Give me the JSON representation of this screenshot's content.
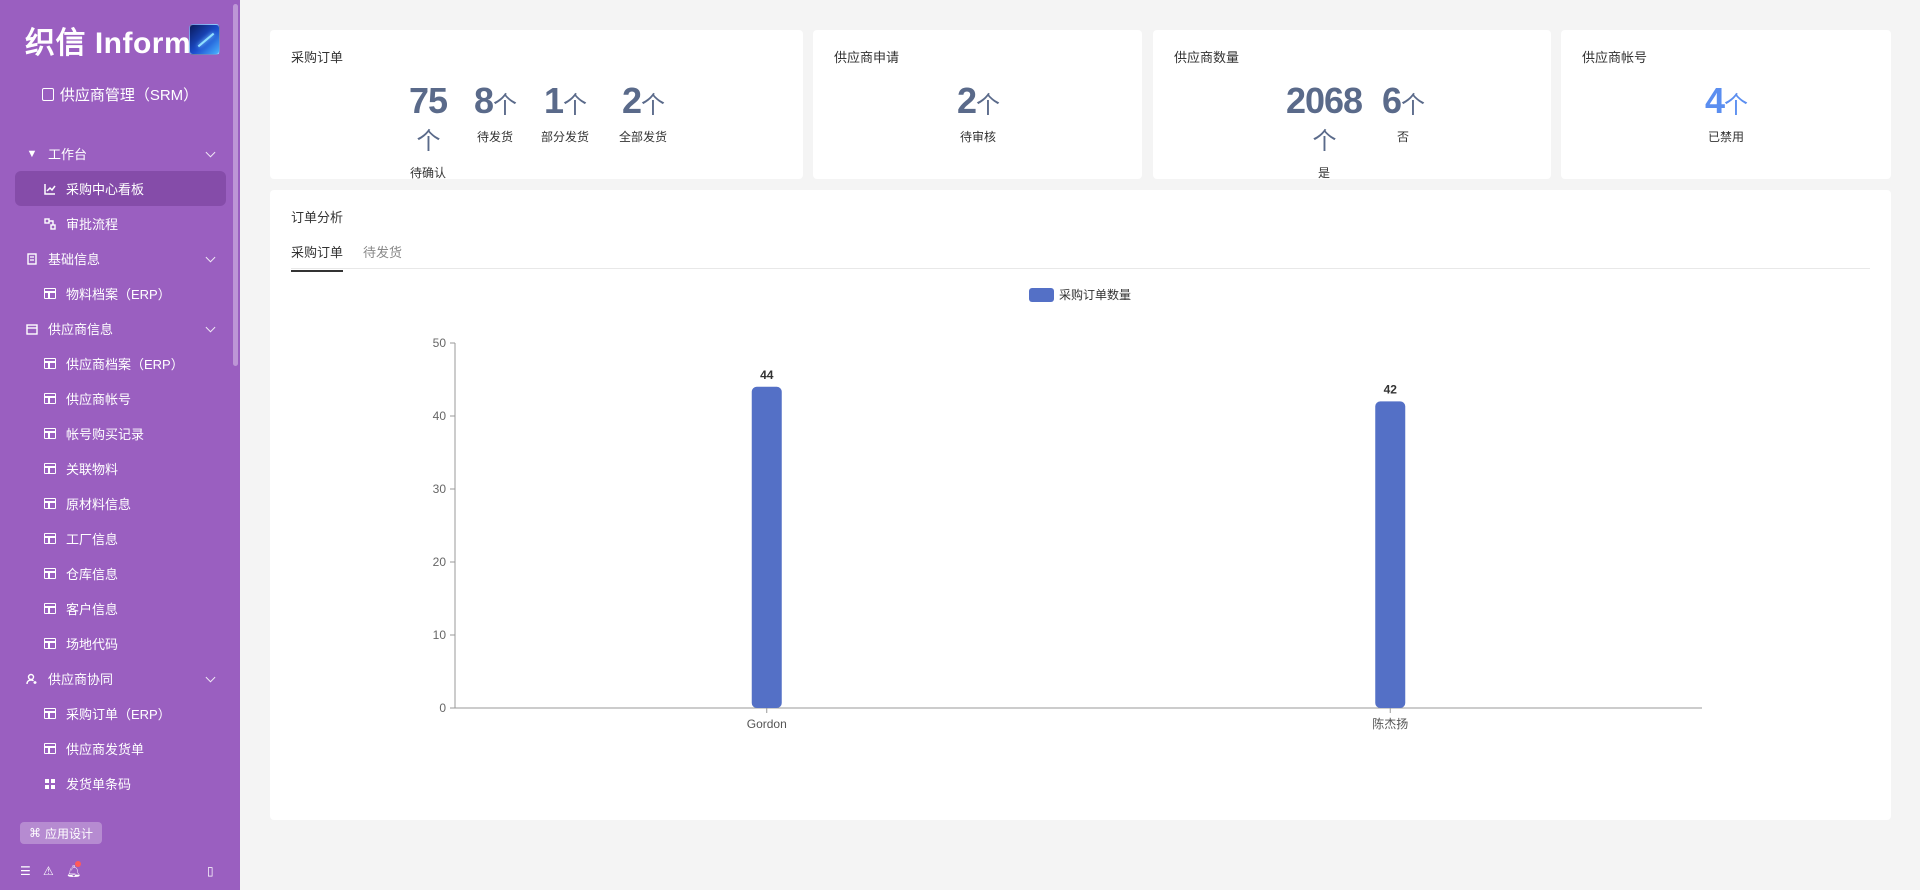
{
  "sidebar": {
    "brand": "织信 Informat",
    "app_name": "供应商管理（SRM）",
    "items": [
      {
        "label": "工作台",
        "type": "group"
      },
      {
        "label": "采购中心看板",
        "type": "child"
      },
      {
        "label": "审批流程",
        "type": "child"
      },
      {
        "label": "基础信息",
        "type": "group"
      },
      {
        "label": "物料档案（ERP）",
        "type": "child"
      },
      {
        "label": "供应商信息",
        "type": "group"
      },
      {
        "label": "供应商档案（ERP）",
        "type": "child"
      },
      {
        "label": "供应商帐号",
        "type": "child"
      },
      {
        "label": "帐号购买记录",
        "type": "child"
      },
      {
        "label": "关联物料",
        "type": "child"
      },
      {
        "label": "原材料信息",
        "type": "child"
      },
      {
        "label": "工厂信息",
        "type": "child"
      },
      {
        "label": "仓库信息",
        "type": "child"
      },
      {
        "label": "客户信息",
        "type": "child"
      },
      {
        "label": "场地代码",
        "type": "child"
      },
      {
        "label": "供应商协同",
        "type": "group"
      },
      {
        "label": "采购订单（ERP）",
        "type": "child"
      },
      {
        "label": "供应商发货单",
        "type": "child"
      },
      {
        "label": "发货单条码",
        "type": "child"
      }
    ],
    "design_button": "应用设计"
  },
  "cards": {
    "purchase_orders": {
      "title": "采购订单",
      "stats": [
        {
          "value": "75",
          "unit": "个",
          "label": "待确认"
        },
        {
          "value": "8",
          "unit": "个",
          "label": "待发货"
        },
        {
          "value": "1",
          "unit": "个",
          "label": "部分发货"
        },
        {
          "value": "2",
          "unit": "个",
          "label": "全部发货"
        }
      ]
    },
    "supplier_applications": {
      "title": "供应商申请",
      "stats": [
        {
          "value": "2",
          "unit": "个",
          "label": "待审核"
        }
      ]
    },
    "supplier_count": {
      "title": "供应商数量",
      "stats": [
        {
          "value": "2068",
          "unit": "个",
          "label": "是"
        },
        {
          "value": "6",
          "unit": "个",
          "label": "否"
        }
      ]
    },
    "supplier_accounts": {
      "title": "供应商帐号",
      "stats": [
        {
          "value": "4",
          "unit": "个",
          "label": "已禁用"
        }
      ]
    }
  },
  "analysis": {
    "title": "订单分析",
    "tabs": [
      "采购订单",
      "待发货"
    ]
  },
  "chart_data": {
    "type": "bar",
    "categories": [
      "Gordon",
      "陈杰扬"
    ],
    "series": [
      {
        "name": "采购订单数量",
        "values": [
          44,
          42
        ]
      }
    ],
    "ylim": [
      0,
      50
    ],
    "yticks": [
      0,
      10,
      20,
      30,
      40,
      50
    ],
    "legend": "top-center",
    "color": "#5470c6",
    "data_labels": true,
    "grid": false
  }
}
